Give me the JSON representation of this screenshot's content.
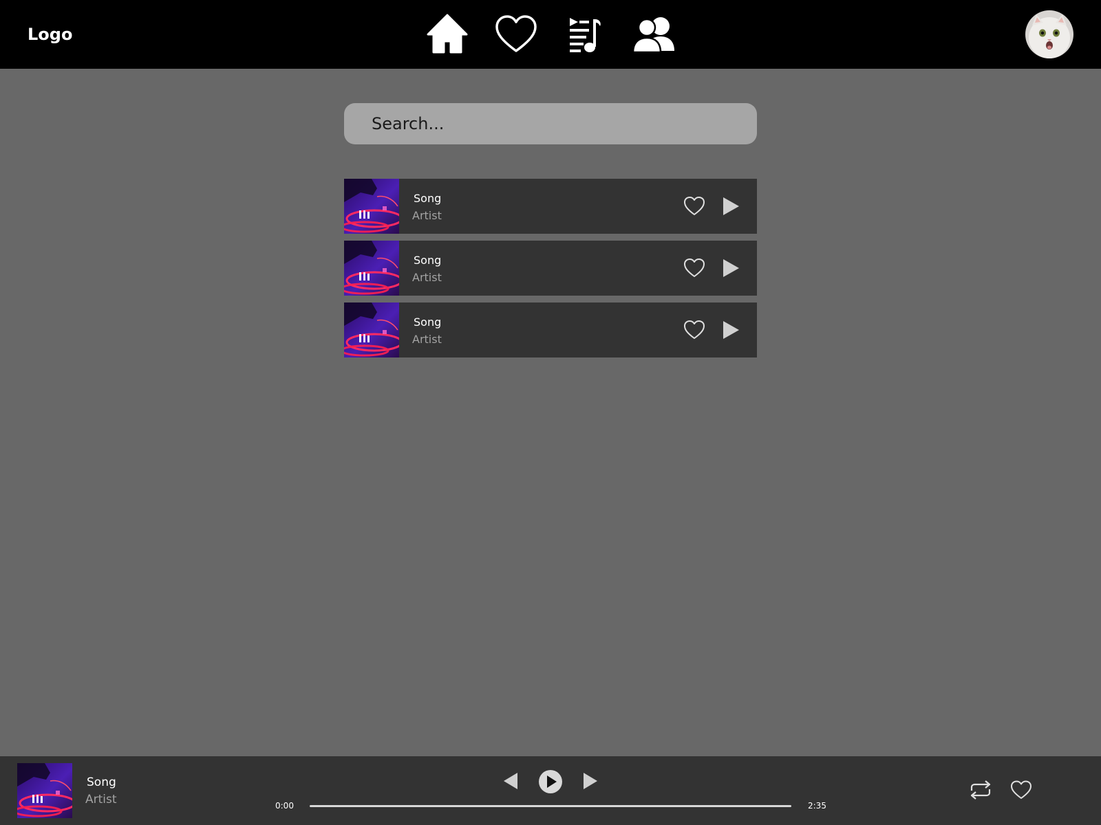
{
  "header": {
    "logo": "Logo",
    "nav": [
      {
        "icon": "home-icon"
      },
      {
        "icon": "heart-icon"
      },
      {
        "icon": "playlist-icon"
      },
      {
        "icon": "users-icon"
      }
    ],
    "avatar_icon": "cat-avatar"
  },
  "search": {
    "placeholder": "Search...",
    "value": ""
  },
  "songs": [
    {
      "title": "Song",
      "artist": "Artist",
      "cover_icon": "album-cover-dj",
      "favorite_icon": "heart-outline-icon",
      "play_icon": "play-icon"
    },
    {
      "title": "Song",
      "artist": "Artist",
      "cover_icon": "album-cover-dj",
      "favorite_icon": "heart-outline-icon",
      "play_icon": "play-icon"
    },
    {
      "title": "Song",
      "artist": "Artist",
      "cover_icon": "album-cover-dj",
      "favorite_icon": "heart-outline-icon",
      "play_icon": "play-icon"
    }
  ],
  "player": {
    "title": "Song",
    "artist": "Artist",
    "current_time": "0:00",
    "duration": "2:35",
    "progress": 0,
    "controls": [
      "previous-icon",
      "play-icon",
      "next-icon",
      "repeat-icon",
      "heart-outline-icon"
    ]
  },
  "colors": {
    "background": "#686868",
    "header": "#000000",
    "row": "#333333",
    "search": "#a6a6a6",
    "muted_text": "#a3a3a3",
    "icon_light": "#d0d0d0"
  }
}
